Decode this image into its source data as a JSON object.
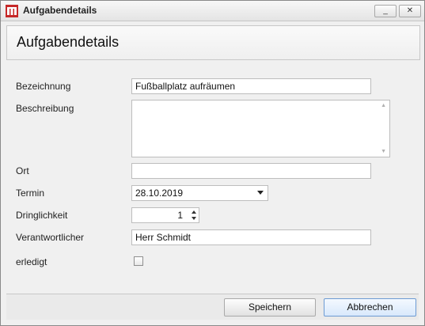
{
  "window": {
    "title": "Aufgabendetails",
    "minimize_symbol": "_",
    "close_symbol": "✕"
  },
  "header": {
    "title": "Aufgabendetails"
  },
  "form": {
    "bezeichnung": {
      "label": "Bezeichnung",
      "value": "Fußballplatz aufräumen"
    },
    "beschreibung": {
      "label": "Beschreibung",
      "value": ""
    },
    "ort": {
      "label": "Ort",
      "value": ""
    },
    "termin": {
      "label": "Termin",
      "value": "28.10.2019"
    },
    "dringlichkeit": {
      "label": "Dringlichkeit",
      "value": "1"
    },
    "verantwortlicher": {
      "label": "Verantwortlicher",
      "value": "Herr Schmidt"
    },
    "erledigt": {
      "label": "erledigt",
      "checked": false
    }
  },
  "buttons": {
    "save": "Speichern",
    "cancel": "Abbrechen"
  },
  "colors": {
    "accent_red": "#c62828",
    "focus_blue": "#6d9bd3"
  },
  "icons": [
    "app-icon",
    "minimize-icon",
    "close-icon",
    "dropdown-arrow-icon",
    "spin-up-icon",
    "spin-down-icon"
  ]
}
